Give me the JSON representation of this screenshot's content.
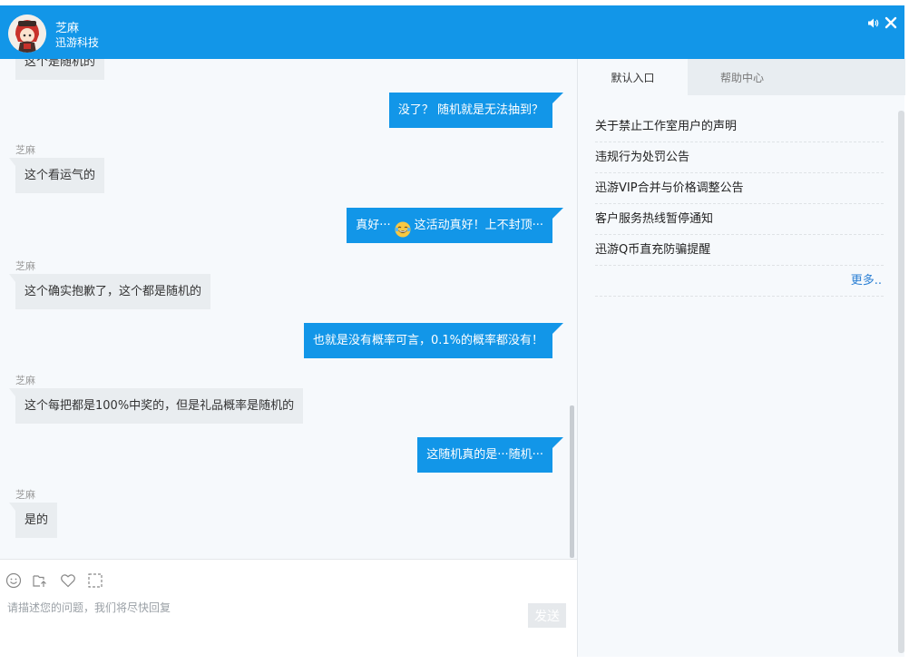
{
  "header": {
    "agent_name": "芝麻",
    "company": "迅游科技"
  },
  "chat": {
    "messages": [
      {
        "side": "left",
        "sender": "",
        "text": "这个是随机的"
      },
      {
        "side": "right",
        "text": "没了？ 随机就是无法抽到？"
      },
      {
        "side": "left",
        "sender": "芝麻",
        "text": "这个看运气的"
      },
      {
        "side": "right",
        "text_before_emoji": "真好···",
        "emoji": "laughing-tears-emoji",
        "text_after_emoji": "这活动真好！上不封顶···"
      },
      {
        "side": "left",
        "sender": "芝麻",
        "text": "这个确实抱歉了，这个都是随机的"
      },
      {
        "side": "right",
        "text": "也就是没有概率可言，0.1%的概率都没有！"
      },
      {
        "side": "left",
        "sender": "芝麻",
        "text": "这个每把都是100%中奖的，但是礼品概率是随机的"
      },
      {
        "side": "right",
        "text": "这随机真的是···随机···"
      },
      {
        "side": "left",
        "sender": "芝麻",
        "text": "是的"
      }
    ]
  },
  "toolbar": {
    "icons": [
      "smiley-icon",
      "upload-file-icon",
      "heart-icon",
      "screenshot-icon"
    ]
  },
  "composer": {
    "placeholder": "请描述您的问题，我们将尽快回复",
    "send_label": "发送"
  },
  "side_panel": {
    "tabs": [
      {
        "label": "默认入口",
        "active": true
      },
      {
        "label": "帮助中心",
        "active": false
      }
    ],
    "notices": [
      "关于禁止工作室用户的声明",
      "违规行为处罚公告",
      "迅游VIP合并与价格调整公告",
      "客户服务热线暂停通知",
      "迅游Q币直充防骗提醒"
    ],
    "more_label": "更多.."
  },
  "colors": {
    "header_bg": "#1296e8",
    "outgoing_bubble": "#1296e8",
    "incoming_bubble": "#e9edf0",
    "link": "#2a7fd4"
  }
}
